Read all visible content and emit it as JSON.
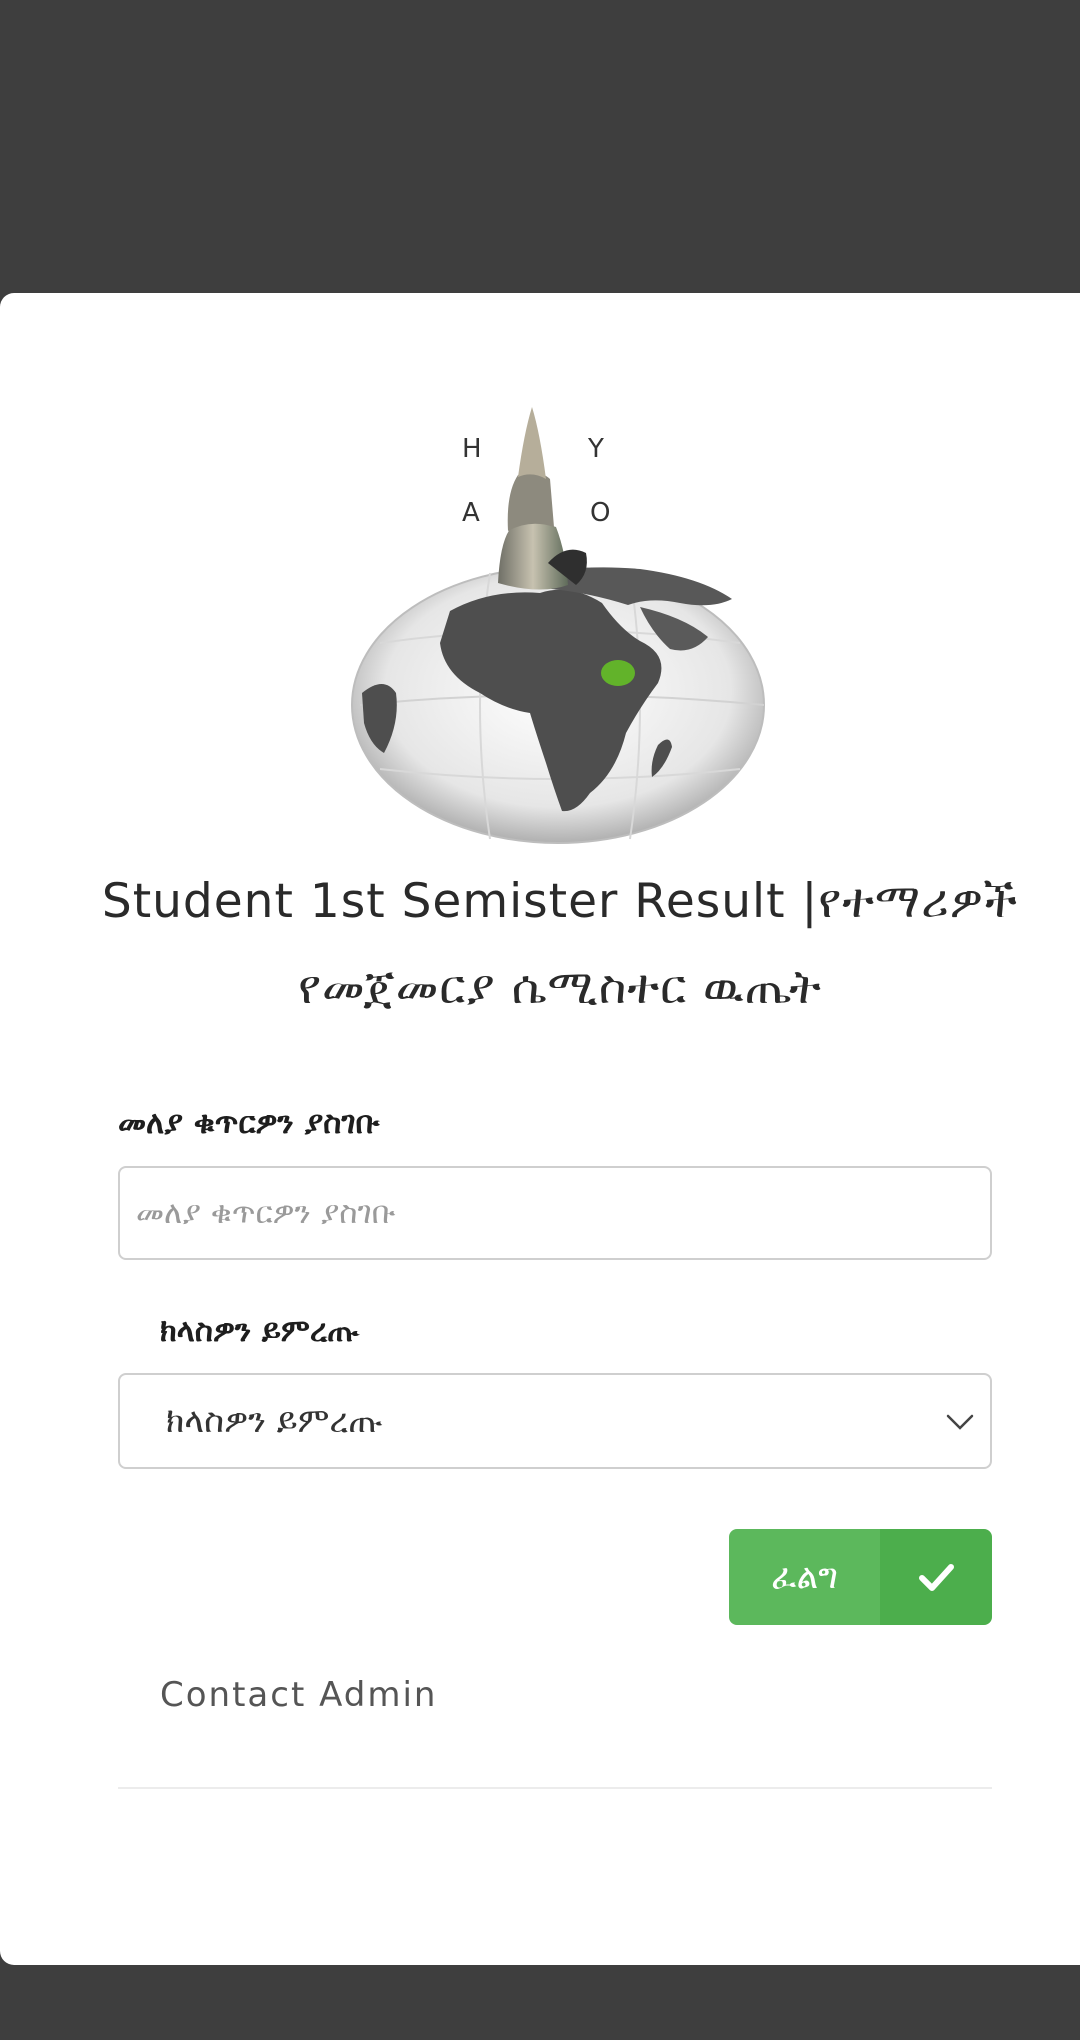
{
  "header": {
    "title_line1": "Student 1st Semister Result |የተማሪዎች",
    "title_line2": "የመጀመርያ ሴሚስተር ዉጤት"
  },
  "logo": {
    "letters": [
      "H",
      "Y",
      "A",
      "O"
    ],
    "icon": "globe-with-scroll-logo"
  },
  "form": {
    "id_label": "መለያ ቁጥርዎን ያስገቡ",
    "id_placeholder": "መለያ ቁጥርዎን ያስገቡ",
    "id_value": "",
    "class_label": "ክላስዎን ይምረጡ",
    "class_selected": "ክላስዎን ይምረጡ",
    "submit_label": "ፈልግ",
    "submit_icon": "check-icon",
    "select_icon": "chevron-down-icon"
  },
  "footer": {
    "contact_label": "Contact Admin"
  },
  "colors": {
    "background": "#3e3e3e",
    "card": "#ffffff",
    "button": "#5cb85c",
    "button_icon_bg": "#4cae4c"
  }
}
